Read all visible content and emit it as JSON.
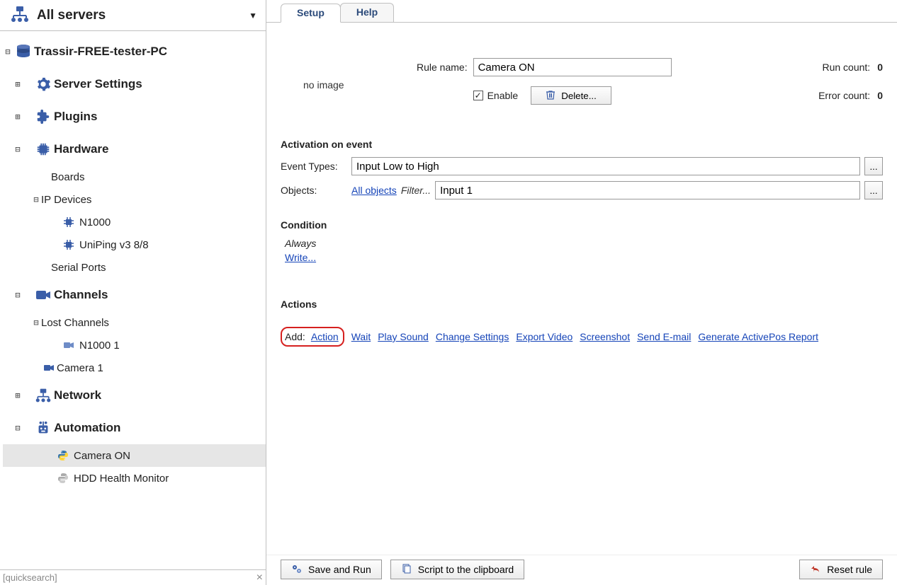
{
  "sidebar": {
    "header_title": "All servers",
    "quicksearch_placeholder": "[quicksearch]",
    "items": [
      {
        "label": "Trassir-FREE-tester-PC"
      },
      {
        "label": "Server Settings"
      },
      {
        "label": "Plugins"
      },
      {
        "label": "Hardware"
      },
      {
        "label": "Boards"
      },
      {
        "label": "IP Devices"
      },
      {
        "label": "N1000"
      },
      {
        "label": "UniPing v3 8/8"
      },
      {
        "label": "Serial Ports"
      },
      {
        "label": "Channels"
      },
      {
        "label": "Lost Channels"
      },
      {
        "label": "N1000 1"
      },
      {
        "label": "Camera 1"
      },
      {
        "label": "Network"
      },
      {
        "label": "Automation"
      },
      {
        "label": "Camera ON"
      },
      {
        "label": "HDD Health Monitor"
      }
    ]
  },
  "tabs": {
    "setup": "Setup",
    "help": "Help"
  },
  "form": {
    "no_image": "no image",
    "rule_name_label": "Rule name:",
    "rule_name_value": "Camera ON",
    "run_count_label": "Run count:",
    "run_count_value": "0",
    "error_count_label": "Error count:",
    "error_count_value": "0",
    "enable_label": "Enable",
    "enable_checked": true,
    "delete_label": "Delete...",
    "activation_head": "Activation on event",
    "event_types_label": "Event Types:",
    "event_types_value": "Input Low to High",
    "objects_label": "Objects:",
    "all_objects_link": "All objects",
    "filter_label": "Filter...",
    "objects_value": "Input 1",
    "condition_head": "Condition",
    "condition_value": "Always",
    "write_link": "Write...",
    "actions_head": "Actions",
    "add_label": "Add:",
    "add_links": {
      "action": "Action",
      "wait": "Wait",
      "play_sound": "Play Sound",
      "change_settings": "Change Settings",
      "export_video": "Export Video",
      "screenshot": "Screenshot",
      "send_email": "Send E-mail",
      "generate_report": "Generate ActivePos Report"
    }
  },
  "footer": {
    "save_and_run": "Save and Run",
    "script_clipboard": "Script to the clipboard",
    "reset_rule": "Reset rule"
  },
  "misc": {
    "ellipsis": "..."
  }
}
